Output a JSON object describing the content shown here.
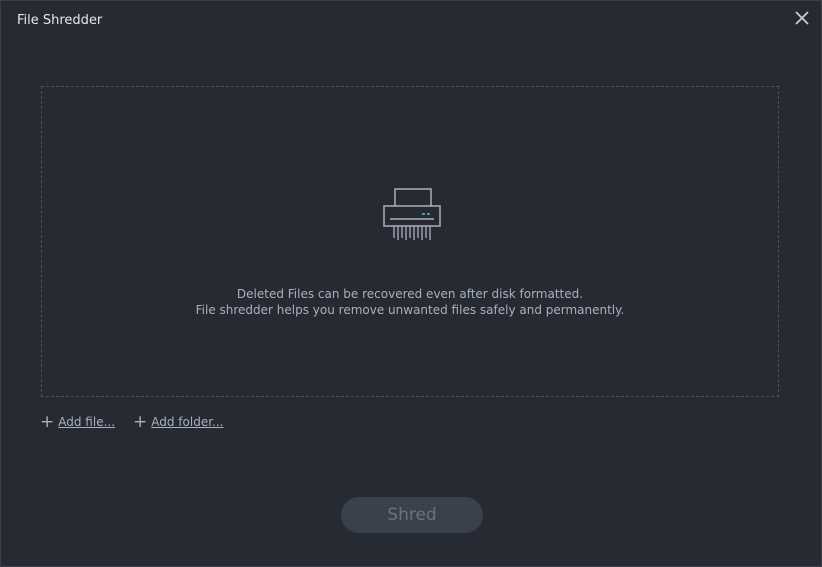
{
  "window": {
    "title": "File Shredder"
  },
  "drop_zone": {
    "line1": "Deleted Files can be recovered even after disk formatted.",
    "line2": "File shredder helps you remove unwanted files safely and permanently."
  },
  "actions": {
    "add_file": "Add file...",
    "add_folder": "Add folder...",
    "shred": "Shred"
  },
  "icons": {
    "close": "close-icon",
    "shredder": "shredder-icon",
    "plus": "plus-icon"
  },
  "colors": {
    "background": "#262a33",
    "accent": "#3ec9b5",
    "text": "#aab0bb"
  }
}
